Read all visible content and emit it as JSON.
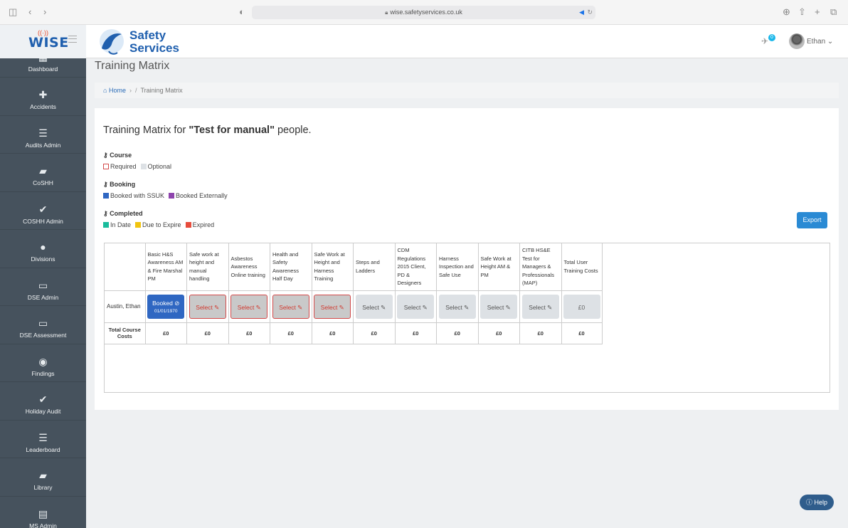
{
  "browser": {
    "url": "wise.safetyservices.co.uk"
  },
  "header": {
    "wise_logo": "WISE",
    "brand_line1": "Safety",
    "brand_line2": "Services",
    "notification_count": "0",
    "user_name": "Ethan"
  },
  "sidebar": {
    "items": [
      {
        "label": "Dashboard",
        "icon": "dashboard-icon",
        "glyph": "▦"
      },
      {
        "label": "Accidents",
        "icon": "medkit-icon",
        "glyph": "✚"
      },
      {
        "label": "Audits Admin",
        "icon": "list-icon",
        "glyph": "☰"
      },
      {
        "label": "CoSHH",
        "icon": "book-icon",
        "glyph": "▰"
      },
      {
        "label": "COSHH Admin",
        "icon": "check-icon",
        "glyph": "✔"
      },
      {
        "label": "Divisions",
        "icon": "users-icon",
        "glyph": "●"
      },
      {
        "label": "DSE Admin",
        "icon": "monitor-icon",
        "glyph": "▭"
      },
      {
        "label": "DSE Assessment",
        "icon": "monitor-icon",
        "glyph": "▭"
      },
      {
        "label": "Findings",
        "icon": "eye-icon",
        "glyph": "◉"
      },
      {
        "label": "Holiday Audit",
        "icon": "check-icon",
        "glyph": "✔"
      },
      {
        "label": "Leaderboard",
        "icon": "list-icon",
        "glyph": "☰"
      },
      {
        "label": "Library",
        "icon": "book-icon",
        "glyph": "▰"
      },
      {
        "label": "MS Admin",
        "icon": "table-icon",
        "glyph": "▤"
      }
    ]
  },
  "page": {
    "title": "Training Matrix",
    "breadcrumb_home": "Home",
    "breadcrumb_current": "Training Matrix",
    "heading_prefix": "Training Matrix for ",
    "heading_group": "\"Test for manual\"",
    "heading_suffix": " people."
  },
  "legend": {
    "course_title": "Course",
    "course_items": [
      {
        "label": "Required",
        "color": "#ffffff",
        "border": "#d34a4a"
      },
      {
        "label": "Optional",
        "color": "#dde1e5",
        "border": "#dde1e5"
      }
    ],
    "booking_title": "Booking",
    "booking_items": [
      {
        "label": "Booked with SSUK",
        "color": "#2f67c2",
        "border": "#2f67c2"
      },
      {
        "label": "Booked Externally",
        "color": "#8e44ad",
        "border": "#8e44ad"
      }
    ],
    "completed_title": "Completed",
    "completed_items": [
      {
        "label": "In Date",
        "color": "#1abc9c",
        "border": "#1abc9c"
      },
      {
        "label": "Due to Expire",
        "color": "#f1c40f",
        "border": "#f1c40f"
      },
      {
        "label": "Expired",
        "color": "#e74c3c",
        "border": "#e74c3c"
      }
    ]
  },
  "export_label": "Export",
  "matrix": {
    "courses": [
      "Basic H&S Awareness AM & Fire Marshal PM",
      "Safe work at height and manual handling",
      "Asbestos Awareness Online training",
      "Health and Safety Awareness Half Day",
      "Safe Work at Height and Harness Training",
      "Steps and Ladders",
      "CDM Regulations 2015 Client, PD & Designers",
      "Harness Inspection and Safe Use",
      "Safe Work at Height AM & PM",
      "CITB HS&E Test for Managers & Professionals (MAP)"
    ],
    "total_user_header": "Total User Training Costs",
    "people": [
      {
        "name": "Austin, Ethan",
        "cells": [
          {
            "status": "booked",
            "label": "Booked",
            "date": "01/01/1970"
          },
          {
            "status": "required",
            "label": "Select"
          },
          {
            "status": "required",
            "label": "Select"
          },
          {
            "status": "required",
            "label": "Select"
          },
          {
            "status": "required",
            "label": "Select"
          },
          {
            "status": "optional",
            "label": "Select"
          },
          {
            "status": "optional",
            "label": "Select"
          },
          {
            "status": "optional",
            "label": "Select"
          },
          {
            "status": "optional",
            "label": "Select"
          },
          {
            "status": "optional",
            "label": "Select"
          }
        ],
        "total": "£0"
      }
    ],
    "totals_label": "Total Course Costs",
    "course_totals": [
      "£0",
      "£0",
      "£0",
      "£0",
      "£0",
      "£0",
      "£0",
      "£0",
      "£0",
      "£0"
    ],
    "grand_total": "£0"
  },
  "help_label": "Help"
}
